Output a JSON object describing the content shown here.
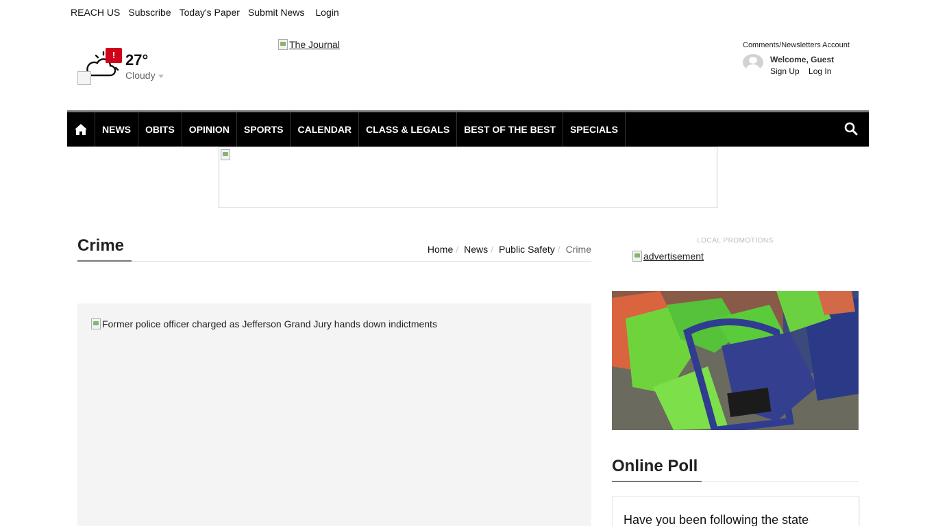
{
  "top_links": {
    "reach_us": "REACH US",
    "subscribe": "Subscribe",
    "todays_paper": "Today's Paper",
    "submit_news": "Submit News",
    "login": "Login"
  },
  "weather": {
    "alert_symbol": "!",
    "temperature": "27°",
    "condition": "Cloudy"
  },
  "logo": {
    "alt": "The Journal"
  },
  "account": {
    "header": "Comments/Newsletters Account",
    "welcome": "Welcome, Guest",
    "sign_up": "Sign Up",
    "log_in": "Log In"
  },
  "nav": {
    "items": [
      "NEWS",
      "OBITS",
      "OPINION",
      "SPORTS",
      "CALENDAR",
      "CLASS & LEGALS",
      "BEST OF THE BEST",
      "SPECIALS"
    ]
  },
  "section": {
    "title": "Crime"
  },
  "breadcrumb": {
    "home": "Home",
    "news": "News",
    "public_safety": "Public Safety",
    "current": "Crime"
  },
  "feature": {
    "alt": "Former police officer charged as Jefferson Grand Jury hands down indictments"
  },
  "sidebar": {
    "promo_label": "LOCAL PROMOTIONS",
    "ad_alt": "advertisement",
    "poll_title": "Online Poll",
    "poll_question": "Have you been following the state"
  },
  "colors": {
    "nav_bg": "#000000",
    "alert_red": "#d0021b",
    "feature_bg": "#f4f4f4"
  }
}
